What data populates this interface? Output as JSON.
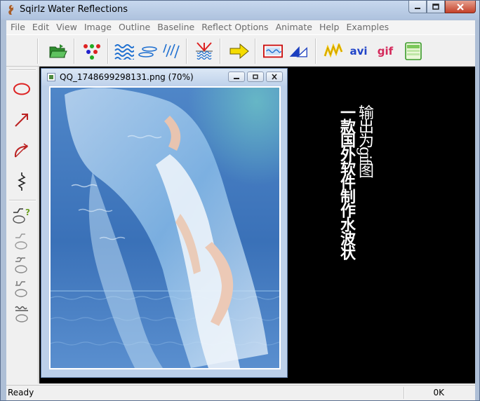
{
  "window": {
    "title": "Sqirlz Water Reflections"
  },
  "menu": [
    "File",
    "Edit",
    "View",
    "Image",
    "Outline",
    "Baseline",
    "Reflect Options",
    "Animate",
    "Help",
    "Examples"
  ],
  "toolbar": {
    "avi_label": "avi",
    "gif_label": "gif"
  },
  "document": {
    "title": "QQ_1748699298131.png  (70%)"
  },
  "canvas_text": {
    "col1": "输出为gif图",
    "col2": "一款国外软件制作水波状"
  },
  "status": {
    "left": "Ready",
    "right": "0K"
  },
  "colors": {
    "workspace": "#000000",
    "toolbar_bg": "#f0f0f0",
    "title_bg": "#aebfd6",
    "close_red": "#c4412a"
  }
}
